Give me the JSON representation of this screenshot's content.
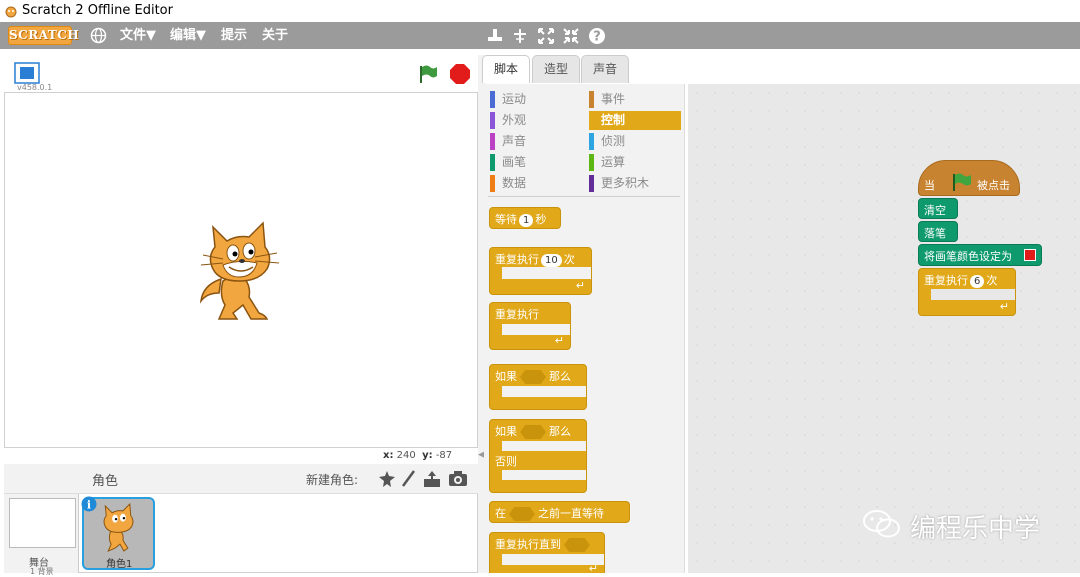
{
  "window": {
    "title": "Scratch 2 Offline Editor"
  },
  "menubar": {
    "logo": "SCRATCH",
    "file": "文件▼",
    "edit": "编辑▼",
    "tips": "提示",
    "about": "关于"
  },
  "stage": {
    "version": "v458.0.1",
    "coord_x_label": "x:",
    "coord_x": "240",
    "coord_y_label": "y:",
    "coord_y": "-87"
  },
  "sprites": {
    "header": "角色",
    "new_sprite": "新建角色:",
    "stage_label": "舞台",
    "stage_sub": "1 背景",
    "sprite_label": "角色1"
  },
  "tabs": [
    "脚本",
    "造型",
    "声音"
  ],
  "categories": [
    {
      "label": "运动",
      "color": "#4a6cd4"
    },
    {
      "label": "事件",
      "color": "#c88330"
    },
    {
      "label": "外观",
      "color": "#8a55d7"
    },
    {
      "label": "控制",
      "color": "#e1a91a",
      "active": true
    },
    {
      "label": "声音",
      "color": "#bb42c3"
    },
    {
      "label": "侦测",
      "color": "#2ca5e2"
    },
    {
      "label": "画笔",
      "color": "#0e9a6c"
    },
    {
      "label": "运算",
      "color": "#5cb712"
    },
    {
      "label": "数据",
      "color": "#ee7d16"
    },
    {
      "label": "更多积木",
      "color": "#632d99"
    }
  ],
  "palette_blocks": {
    "wait": "等待",
    "wait_val": "1",
    "wait_unit": "秒",
    "repeat": "重复执行",
    "repeat_val": "10",
    "repeat_unit": "次",
    "forever": "重复执行",
    "if": "如果",
    "then": "那么",
    "if2": "如果",
    "then2": "那么",
    "else": "否则",
    "wait_until_pre": "在",
    "wait_until": "之前一直等待",
    "repeat_until": "重复执行直到"
  },
  "script": {
    "hat_when": "当",
    "hat_clicked": "被点击",
    "clear": "清空",
    "pen_down": "落笔",
    "set_color": "将画笔颜色设定为",
    "repeat": "重复执行",
    "repeat_val": "6",
    "repeat_unit": "次"
  },
  "watermark": "编程乐中学"
}
